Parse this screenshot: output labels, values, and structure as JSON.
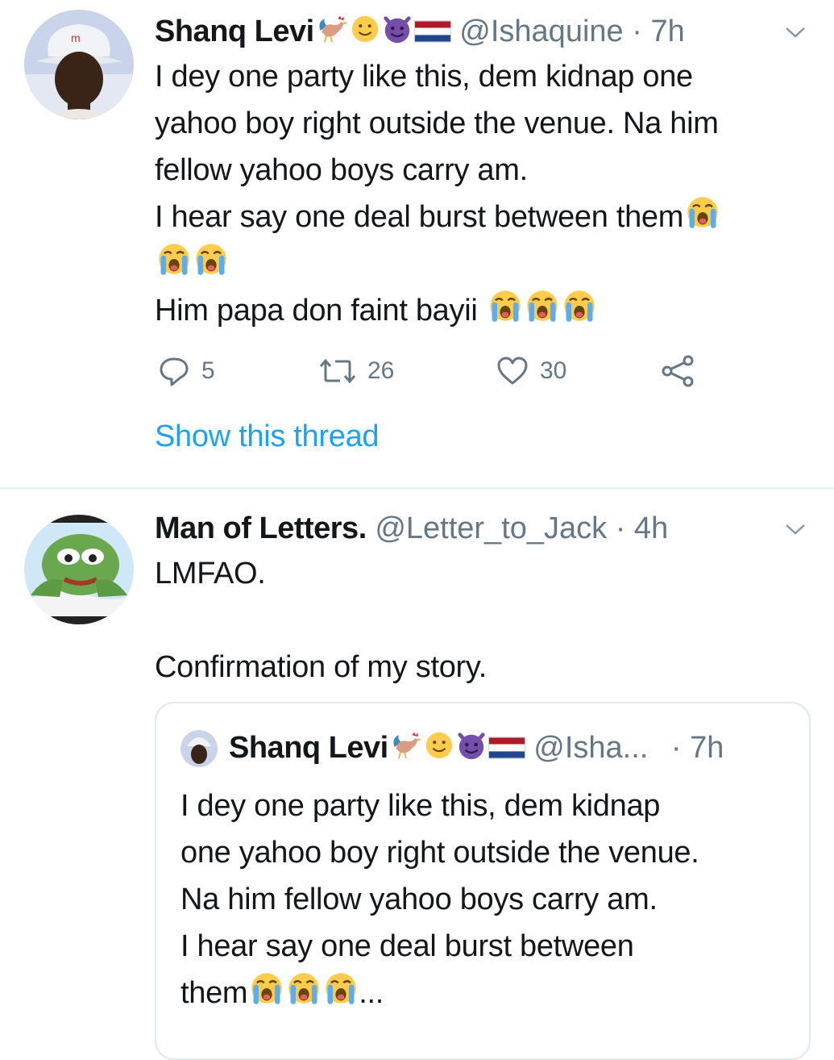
{
  "tweet1": {
    "name": "Shanq Levi",
    "handle": "@Ishaquine",
    "time": "· 7h",
    "lines": [
      "I dey one party like this, dem kidnap one",
      "yahoo boy right outside the venue. Na him",
      "fellow yahoo boys carry am.",
      "I hear say one deal burst between them"
    ],
    "last_line": "Him papa don faint bayii",
    "reply_count": "5",
    "retweet_count": "26",
    "like_count": "30",
    "show_thread": "Show this thread"
  },
  "tweet2": {
    "name": "Man of Letters.",
    "handle": "@Letter_to_Jack",
    "time": "· 4h",
    "line1": "LMFAO.",
    "line2": "Confirmation of my story."
  },
  "quoted": {
    "name": "Shanq Levi",
    "handle": "@Isha...",
    "time": "· 7h",
    "lines": [
      "I dey one party like this, dem kidnap",
      "one yahoo boy right outside the venue.",
      "Na him fellow yahoo boys carry am.",
      "I hear say one deal burst between"
    ],
    "last_word": "them",
    "ellipsis": "..."
  },
  "colors": {
    "accent": "#1da1f2",
    "muted": "#657786",
    "text": "#14171a"
  },
  "icons": [
    "rooster-emoji",
    "smiling-face-emoji",
    "smiling-devil-emoji",
    "netherlands-flag-emoji",
    "loudly-crying-face-emoji",
    "chevron-down-icon",
    "reply-icon",
    "retweet-icon",
    "like-icon",
    "share-icon"
  ]
}
